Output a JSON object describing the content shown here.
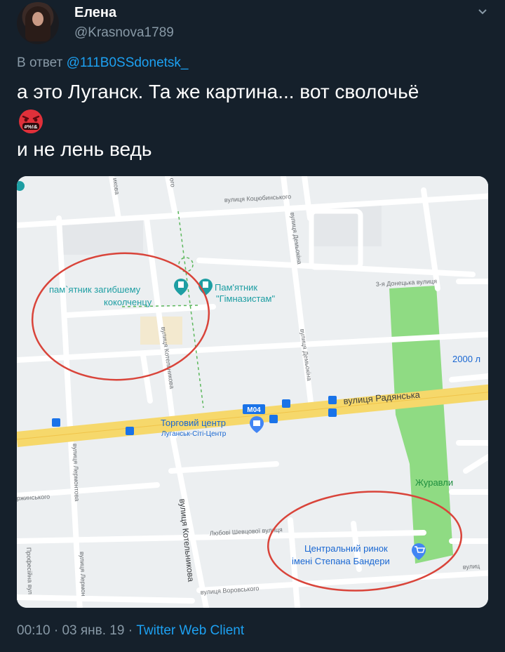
{
  "tweet": {
    "author_name": "Елена",
    "author_handle": "@Krasnova1789",
    "reply_prefix": "В ответ",
    "reply_handle": "@111B0SSdonetsk_",
    "text_line1": "а это Луганск. Та же картина... вот сволочьё",
    "emoji": "angry-face-with-symbols",
    "emoji_symbols": "#%!&",
    "text_line3": "и не лень ведь",
    "time": "00:10",
    "date": "03 янв. 19",
    "separator": "·",
    "client": "Twitter Web Client"
  },
  "map": {
    "streets": {
      "kotsyubynskoho": "вулиця Коцюбинського",
      "demyokina_top": "вулиця Демьокіна",
      "demyokina_mid": "вулиця Демьокіна",
      "donetska": "3-я Донецька вулиця",
      "radyanska": "вулиця Радянська",
      "kotelnykova_mid": "вулиця Котельникова",
      "kotelnykova_bottom": "вулиця Котельникова",
      "lermontova": "вулиця Лермонтова",
      "lermontova_bottom": "вулиця Лермон",
      "dzerzhynskoho": "ржинського",
      "shevtsovoi": "Любові Шевцової вулиця",
      "vorovskoho": "вулиця Воровського",
      "profspilkova": "Професійна вул",
      "top_left": "икова",
      "top_mid": "ого",
      "right_edge": "вулиц"
    },
    "places": {
      "monument1_line1": "пам`ятник загибшему",
      "monument1_line2": "коколченцу",
      "monument2_line1": "Пам'ятник",
      "monument2_line2": "\"Гімназистам\"",
      "mall_line1": "Торговий центр",
      "mall_line2": "Луганськ-Сіті-Центр",
      "market_line1": "Центральний ринок",
      "market_line2": "імені Степана Бандери",
      "zhuravli": "Журавли",
      "school": "2000 л"
    },
    "road_badge": "M04",
    "colors": {
      "road_major": "#f6d86b",
      "park": "#8fdb83",
      "poi_teal": "#1e9ea3",
      "poi_blue": "#4285f4",
      "circle": "#d9443a",
      "street_label": "#6b6f73"
    }
  }
}
